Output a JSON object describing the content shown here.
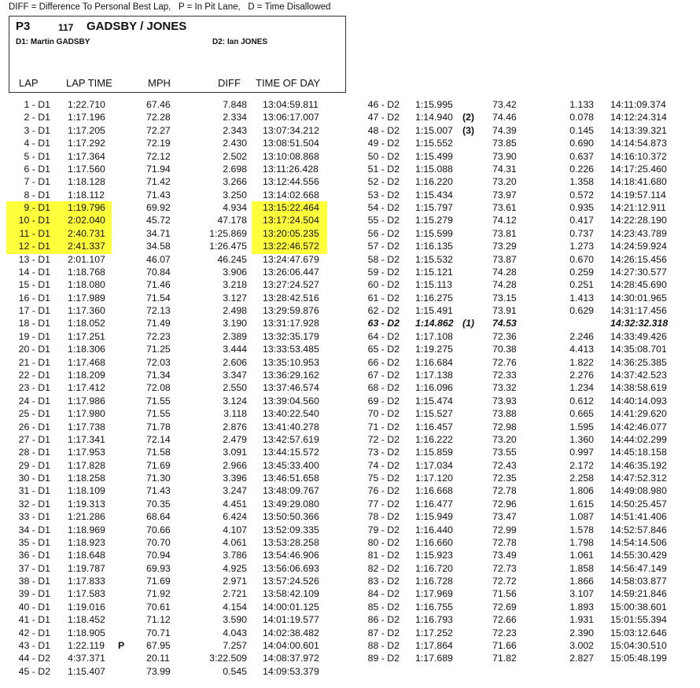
{
  "legend": "DIFF = Difference To Personal Best Lap,   P = In Pit Lane,   D = Time Disallowed",
  "entry": {
    "position": "P3",
    "car_number": "117",
    "team": "GADSBY / JONES",
    "driver1": "D1:     Martin GADSBY",
    "driver2": "D2:     Ian JONES"
  },
  "headers": {
    "lap": "LAP",
    "lap_time": "LAP TIME",
    "mph": "MPH",
    "diff": "DIFF",
    "time_of_day": "TIME OF DAY"
  },
  "left_laps": [
    {
      "lap": "1 - D1",
      "time": "1:22.710",
      "mph": "67.46",
      "diff": "7.848",
      "tod": "13:04:59.811"
    },
    {
      "lap": "2 - D1",
      "time": "1:17.196",
      "mph": "72.28",
      "diff": "2.334",
      "tod": "13:06:17.007"
    },
    {
      "lap": "3 - D1",
      "time": "1:17.205",
      "mph": "72.27",
      "diff": "2.343",
      "tod": "13:07:34.212"
    },
    {
      "lap": "4 - D1",
      "time": "1:17.292",
      "mph": "72.19",
      "diff": "2.430",
      "tod": "13:08:51.504"
    },
    {
      "lap": "5 - D1",
      "time": "1:17.364",
      "mph": "72.12",
      "diff": "2.502",
      "tod": "13:10:08.868"
    },
    {
      "lap": "6 - D1",
      "time": "1:17.560",
      "mph": "71.94",
      "diff": "2.698",
      "tod": "13:11:26.428"
    },
    {
      "lap": "7 - D1",
      "time": "1:18.128",
      "mph": "71.42",
      "diff": "3.266",
      "tod": "13:12:44.556"
    },
    {
      "lap": "8 - D1",
      "time": "1:18.112",
      "mph": "71.43",
      "diff": "3.250",
      "tod": "13:14:02.668"
    },
    {
      "lap": "9 - D1",
      "time": "1:19.796",
      "mph": "69.92",
      "diff": "4.934",
      "tod": "13:15:22.464",
      "hl": true
    },
    {
      "lap": "10 - D1",
      "time": "2:02.040",
      "mph": "45.72",
      "diff": "47.178",
      "tod": "13:17:24.504",
      "hl": true
    },
    {
      "lap": "11 - D1",
      "time": "2:40.731",
      "mph": "34.71",
      "diff": "1:25.869",
      "tod": "13:20:05.235",
      "hl": true
    },
    {
      "lap": "12 - D1",
      "time": "2:41.337",
      "mph": "34.58",
      "diff": "1:26.475",
      "tod": "13:22:46.572",
      "hl": true
    },
    {
      "lap": "13 - D1",
      "time": "2:01.107",
      "mph": "46.07",
      "diff": "46.245",
      "tod": "13:24:47.679"
    },
    {
      "lap": "14 - D1",
      "time": "1:18.768",
      "mph": "70.84",
      "diff": "3.906",
      "tod": "13:26:06.447"
    },
    {
      "lap": "15 - D1",
      "time": "1:18.080",
      "mph": "71.46",
      "diff": "3.218",
      "tod": "13:27:24.527"
    },
    {
      "lap": "16 - D1",
      "time": "1:17.989",
      "mph": "71.54",
      "diff": "3.127",
      "tod": "13:28:42.516"
    },
    {
      "lap": "17 - D1",
      "time": "1:17.360",
      "mph": "72.13",
      "diff": "2.498",
      "tod": "13:29:59.876"
    },
    {
      "lap": "18 - D1",
      "time": "1:18.052",
      "mph": "71.49",
      "diff": "3.190",
      "tod": "13:31:17.928"
    },
    {
      "lap": "19 - D1",
      "time": "1:17.251",
      "mph": "72.23",
      "diff": "2.389",
      "tod": "13:32:35.179"
    },
    {
      "lap": "20 - D1",
      "time": "1:18.306",
      "mph": "71.25",
      "diff": "3.444",
      "tod": "13:33:53.485"
    },
    {
      "lap": "21 - D1",
      "time": "1:17.468",
      "mph": "72.03",
      "diff": "2.606",
      "tod": "13:35:10.953"
    },
    {
      "lap": "22 - D1",
      "time": "1:18.209",
      "mph": "71.34",
      "diff": "3.347",
      "tod": "13:36:29.162"
    },
    {
      "lap": "23 - D1",
      "time": "1:17.412",
      "mph": "72.08",
      "diff": "2.550",
      "tod": "13:37:46.574"
    },
    {
      "lap": "24 - D1",
      "time": "1:17.986",
      "mph": "71.55",
      "diff": "3.124",
      "tod": "13:39:04.560"
    },
    {
      "lap": "25 - D1",
      "time": "1:17.980",
      "mph": "71.55",
      "diff": "3.118",
      "tod": "13:40:22.540"
    },
    {
      "lap": "26 - D1",
      "time": "1:17.738",
      "mph": "71.78",
      "diff": "2.876",
      "tod": "13:41:40.278"
    },
    {
      "lap": "27 - D1",
      "time": "1:17.341",
      "mph": "72.14",
      "diff": "2.479",
      "tod": "13:42:57.619"
    },
    {
      "lap": "28 - D1",
      "time": "1:17.953",
      "mph": "71.58",
      "diff": "3.091",
      "tod": "13:44:15.572"
    },
    {
      "lap": "29 - D1",
      "time": "1:17.828",
      "mph": "71.69",
      "diff": "2.966",
      "tod": "13:45:33.400"
    },
    {
      "lap": "30 - D1",
      "time": "1:18.258",
      "mph": "71.30",
      "diff": "3.396",
      "tod": "13:46:51.658"
    },
    {
      "lap": "31 - D1",
      "time": "1:18.109",
      "mph": "71.43",
      "diff": "3.247",
      "tod": "13:48:09.767"
    },
    {
      "lap": "32 - D1",
      "time": "1:19.313",
      "mph": "70.35",
      "diff": "4.451",
      "tod": "13:49:29.080"
    },
    {
      "lap": "33 - D1",
      "time": "1:21.286",
      "mph": "68.64",
      "diff": "6.424",
      "tod": "13:50:50.366"
    },
    {
      "lap": "34 - D1",
      "time": "1:18.969",
      "mph": "70.66",
      "diff": "4.107",
      "tod": "13:52:09.335"
    },
    {
      "lap": "35 - D1",
      "time": "1:18.923",
      "mph": "70.70",
      "diff": "4.061",
      "tod": "13:53:28.258"
    },
    {
      "lap": "36 - D1",
      "time": "1:18.648",
      "mph": "70.94",
      "diff": "3.786",
      "tod": "13:54:46.906"
    },
    {
      "lap": "37 - D1",
      "time": "1:19.787",
      "mph": "69.93",
      "diff": "4.925",
      "tod": "13:56:06.693"
    },
    {
      "lap": "38 - D1",
      "time": "1:17.833",
      "mph": "71.69",
      "diff": "2.971",
      "tod": "13:57:24.526"
    },
    {
      "lap": "39 - D1",
      "time": "1:17.583",
      "mph": "71.92",
      "diff": "2.721",
      "tod": "13:58:42.109"
    },
    {
      "lap": "40 - D1",
      "time": "1:19.016",
      "mph": "70.61",
      "diff": "4.154",
      "tod": "14:00:01.125"
    },
    {
      "lap": "41 - D1",
      "time": "1:18.452",
      "mph": "71.12",
      "diff": "3.590",
      "tod": "14:01:19.577"
    },
    {
      "lap": "42 - D1",
      "time": "1:18.905",
      "mph": "70.71",
      "diff": "4.043",
      "tod": "14:02:38.482"
    },
    {
      "lap": "43 - D1",
      "time": "1:22.119",
      "flag": "P",
      "mph": "67.95",
      "diff": "7.257",
      "tod": "14:04:00.601"
    },
    {
      "lap": "44 - D2",
      "time": "4:37.371",
      "mph": "20.11",
      "diff": "3:22.509",
      "tod": "14:08:37.972"
    },
    {
      "lap": "45 - D2",
      "time": "1:15.407",
      "mph": "73.99",
      "diff": "0.545",
      "tod": "14:09:53.379"
    }
  ],
  "right_laps": [
    {
      "lap": "46 - D2",
      "time": "1:15.995",
      "mph": "73.42",
      "diff": "1.133",
      "tod": "14:11:09.374"
    },
    {
      "lap": "47 - D2",
      "time": "1:14.940",
      "flag": "(2)",
      "mph": "74.46",
      "diff": "0.078",
      "tod": "14:12:24.314"
    },
    {
      "lap": "48 - D2",
      "time": "1:15.007",
      "flag": "(3)",
      "mph": "74.39",
      "diff": "0.145",
      "tod": "14:13:39.321"
    },
    {
      "lap": "49 - D2",
      "time": "1:15.552",
      "mph": "73.85",
      "diff": "0.690",
      "tod": "14:14:54.873"
    },
    {
      "lap": "50 - D2",
      "time": "1:15.499",
      "mph": "73.90",
      "diff": "0.637",
      "tod": "14:16:10.372"
    },
    {
      "lap": "51 - D2",
      "time": "1:15.088",
      "mph": "74.31",
      "diff": "0.226",
      "tod": "14:17:25.460"
    },
    {
      "lap": "52 - D2",
      "time": "1:16.220",
      "mph": "73.20",
      "diff": "1.358",
      "tod": "14:18:41.680"
    },
    {
      "lap": "53 - D2",
      "time": "1:15.434",
      "mph": "73.97",
      "diff": "0.572",
      "tod": "14:19:57.114"
    },
    {
      "lap": "54 - D2",
      "time": "1:15.797",
      "mph": "73.61",
      "diff": "0.935",
      "tod": "14:21:12.911"
    },
    {
      "lap": "55 - D2",
      "time": "1:15.279",
      "mph": "74.12",
      "diff": "0.417",
      "tod": "14:22:28.190"
    },
    {
      "lap": "56 - D2",
      "time": "1:15.599",
      "mph": "73.81",
      "diff": "0.737",
      "tod": "14:23:43.789"
    },
    {
      "lap": "57 - D2",
      "time": "1:16.135",
      "mph": "73.29",
      "diff": "1.273",
      "tod": "14:24:59.924"
    },
    {
      "lap": "58 - D2",
      "time": "1:15.532",
      "mph": "73.87",
      "diff": "0.670",
      "tod": "14:26:15.456"
    },
    {
      "lap": "59 - D2",
      "time": "1:15.121",
      "mph": "74.28",
      "diff": "0.259",
      "tod": "14:27:30.577"
    },
    {
      "lap": "60 - D2",
      "time": "1:15.113",
      "mph": "74.28",
      "diff": "0.251",
      "tod": "14:28:45.690"
    },
    {
      "lap": "61 - D2",
      "time": "1:16.275",
      "mph": "73.15",
      "diff": "1.413",
      "tod": "14:30:01.965"
    },
    {
      "lap": "62 - D2",
      "time": "1:15.491",
      "mph": "73.91",
      "diff": "0.629",
      "tod": "14:31:17.456"
    },
    {
      "lap": "63 - D2",
      "time": "1:14.862",
      "flag": "(1)",
      "mph": "74.53",
      "diff": "",
      "tod": "14:32:32.318",
      "best": true
    },
    {
      "lap": "64 - D2",
      "time": "1:17.108",
      "mph": "72.36",
      "diff": "2.246",
      "tod": "14:33:49.426"
    },
    {
      "lap": "65 - D2",
      "time": "1:19.275",
      "mph": "70.38",
      "diff": "4.413",
      "tod": "14:35:08.701"
    },
    {
      "lap": "66 - D2",
      "time": "1:16.684",
      "mph": "72.76",
      "diff": "1.822",
      "tod": "14:36:25.385"
    },
    {
      "lap": "67 - D2",
      "time": "1:17.138",
      "mph": "72.33",
      "diff": "2.276",
      "tod": "14:37:42.523"
    },
    {
      "lap": "68 - D2",
      "time": "1:16.096",
      "mph": "73.32",
      "diff": "1.234",
      "tod": "14:38:58.619"
    },
    {
      "lap": "69 - D2",
      "time": "1:15.474",
      "mph": "73.93",
      "diff": "0.612",
      "tod": "14:40:14.093"
    },
    {
      "lap": "70 - D2",
      "time": "1:15.527",
      "mph": "73.88",
      "diff": "0.665",
      "tod": "14:41:29.620"
    },
    {
      "lap": "71 - D2",
      "time": "1:16.457",
      "mph": "72.98",
      "diff": "1.595",
      "tod": "14:42:46.077"
    },
    {
      "lap": "72 - D2",
      "time": "1:16.222",
      "mph": "73.20",
      "diff": "1.360",
      "tod": "14:44:02.299"
    },
    {
      "lap": "73 - D2",
      "time": "1:15.859",
      "mph": "73.55",
      "diff": "0.997",
      "tod": "14:45:18.158"
    },
    {
      "lap": "74 - D2",
      "time": "1:17.034",
      "mph": "72.43",
      "diff": "2.172",
      "tod": "14:46:35.192"
    },
    {
      "lap": "75 - D2",
      "time": "1:17.120",
      "mph": "72.35",
      "diff": "2.258",
      "tod": "14:47:52.312"
    },
    {
      "lap": "76 - D2",
      "time": "1:16.668",
      "mph": "72.78",
      "diff": "1.806",
      "tod": "14:49:08.980"
    },
    {
      "lap": "77 - D2",
      "time": "1:16.477",
      "mph": "72.96",
      "diff": "1.615",
      "tod": "14:50:25.457"
    },
    {
      "lap": "78 - D2",
      "time": "1:15.949",
      "mph": "73.47",
      "diff": "1.087",
      "tod": "14:51:41.406"
    },
    {
      "lap": "79 - D2",
      "time": "1:16.440",
      "mph": "72.99",
      "diff": "1.578",
      "tod": "14:52:57.846"
    },
    {
      "lap": "80 - D2",
      "time": "1:16.660",
      "mph": "72.78",
      "diff": "1.798",
      "tod": "14:54:14.506"
    },
    {
      "lap": "81 - D2",
      "time": "1:15.923",
      "mph": "73.49",
      "diff": "1.061",
      "tod": "14:55:30.429"
    },
    {
      "lap": "82 - D2",
      "time": "1:16.720",
      "mph": "72.73",
      "diff": "1.858",
      "tod": "14:56:47.149"
    },
    {
      "lap": "83 - D2",
      "time": "1:16.728",
      "mph": "72.72",
      "diff": "1.866",
      "tod": "14:58:03.877"
    },
    {
      "lap": "84 - D2",
      "time": "1:17.969",
      "mph": "71.56",
      "diff": "3.107",
      "tod": "14:59:21.846"
    },
    {
      "lap": "85 - D2",
      "time": "1:16.755",
      "mph": "72.69",
      "diff": "1.893",
      "tod": "15:00:38.601"
    },
    {
      "lap": "86 - D2",
      "time": "1:16.793",
      "mph": "72.66",
      "diff": "1.931",
      "tod": "15:01:55.394"
    },
    {
      "lap": "87 - D2",
      "time": "1:17.252",
      "mph": "72.23",
      "diff": "2.390",
      "tod": "15:03:12.646"
    },
    {
      "lap": "88 - D2",
      "time": "1:17.864",
      "mph": "71.66",
      "diff": "3.002",
      "tod": "15:04:30.510"
    },
    {
      "lap": "89 - D2",
      "time": "1:17.689",
      "mph": "71.82",
      "diff": "2.827",
      "tod": "15:05:48.199"
    }
  ]
}
